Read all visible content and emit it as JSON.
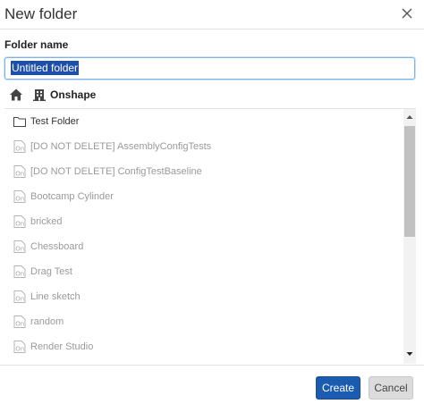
{
  "dialog": {
    "title": "New folder",
    "field_label": "Folder name",
    "folder_name_value": "Untitled folder"
  },
  "breadcrumb": {
    "home_icon": "home-icon",
    "company_icon": "building-icon",
    "company_label": "Onshape"
  },
  "items": [
    {
      "label": "Test Folder",
      "icon": "folder-icon",
      "enabled": true
    },
    {
      "label": "[DO NOT DELETE] AssemblyConfigTests",
      "icon": "onshape-document-icon",
      "enabled": false
    },
    {
      "label": "[DO NOT DELETE] ConfigTestBaseline",
      "icon": "onshape-document-icon",
      "enabled": false
    },
    {
      "label": "Bootcamp Cylinder",
      "icon": "onshape-document-icon",
      "enabled": false
    },
    {
      "label": "bricked",
      "icon": "onshape-document-icon",
      "enabled": false
    },
    {
      "label": "Chessboard",
      "icon": "onshape-document-icon",
      "enabled": false
    },
    {
      "label": "Drag Test",
      "icon": "onshape-document-icon",
      "enabled": false
    },
    {
      "label": "Line sketch",
      "icon": "onshape-document-icon",
      "enabled": false
    },
    {
      "label": "random",
      "icon": "onshape-document-icon",
      "enabled": false
    },
    {
      "label": "Render Studio",
      "icon": "onshape-document-icon",
      "enabled": false
    }
  ],
  "buttons": {
    "create_label": "Create",
    "cancel_label": "Cancel"
  },
  "colors": {
    "primary": "#1b5bb0",
    "selection": "#1e4fa8",
    "disabled_text": "#9a9a9a"
  }
}
